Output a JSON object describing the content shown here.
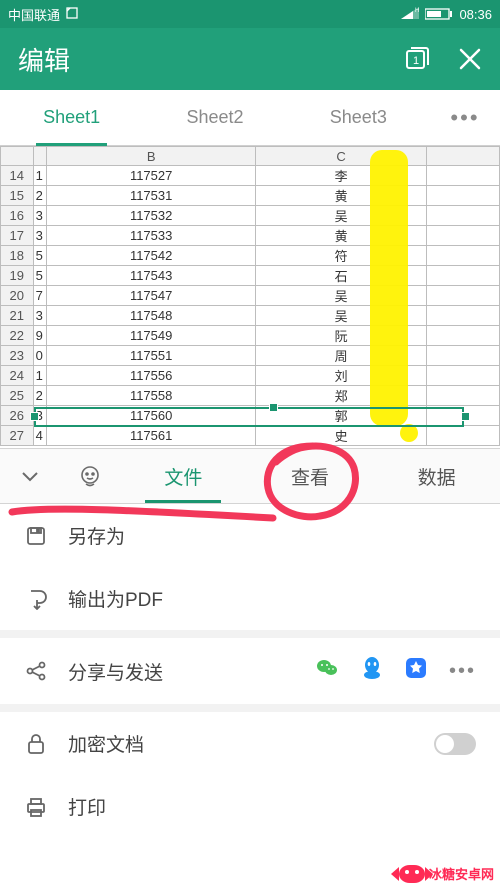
{
  "statusbar": {
    "carrier": "中国联通",
    "time": "08:36"
  },
  "titlebar": {
    "title": "编辑"
  },
  "sheet_tabs": [
    "Sheet1",
    "Sheet2",
    "Sheet3"
  ],
  "active_sheet": 0,
  "columns": [
    "",
    "B",
    "C"
  ],
  "rows": [
    {
      "n": "14",
      "a": "1",
      "b": "117527",
      "c": "李"
    },
    {
      "n": "15",
      "a": "2",
      "b": "117531",
      "c": "黄"
    },
    {
      "n": "16",
      "a": "3",
      "b": "117532",
      "c": "吴"
    },
    {
      "n": "17",
      "a": "3",
      "b": "117533",
      "c": "黄"
    },
    {
      "n": "18",
      "a": "5",
      "b": "117542",
      "c": "符"
    },
    {
      "n": "19",
      "a": "5",
      "b": "117543",
      "c": "石"
    },
    {
      "n": "20",
      "a": "7",
      "b": "117547",
      "c": "吴"
    },
    {
      "n": "21",
      "a": "3",
      "b": "117548",
      "c": "吴"
    },
    {
      "n": "22",
      "a": "9",
      "b": "117549",
      "c": "阮"
    },
    {
      "n": "23",
      "a": "0",
      "b": "117551",
      "c": "周"
    },
    {
      "n": "24",
      "a": "1",
      "b": "117556",
      "c": "刘"
    },
    {
      "n": "25",
      "a": "2",
      "b": "117558",
      "c": "郑"
    },
    {
      "n": "26",
      "a": "3",
      "b": "117560",
      "c": "郭"
    },
    {
      "n": "27",
      "a": "4",
      "b": "117561",
      "c": "史"
    }
  ],
  "selected_row": "26",
  "toolbar_tabs": {
    "file": "文件",
    "view": "查看",
    "data": "数据"
  },
  "active_toolbar_tab": "file",
  "menu": {
    "save_as": "另存为",
    "export_pdf": "输出为PDF",
    "share": "分享与发送",
    "encrypt": "加密文档",
    "print": "打印"
  },
  "watermark_text": "冰糖安卓网"
}
